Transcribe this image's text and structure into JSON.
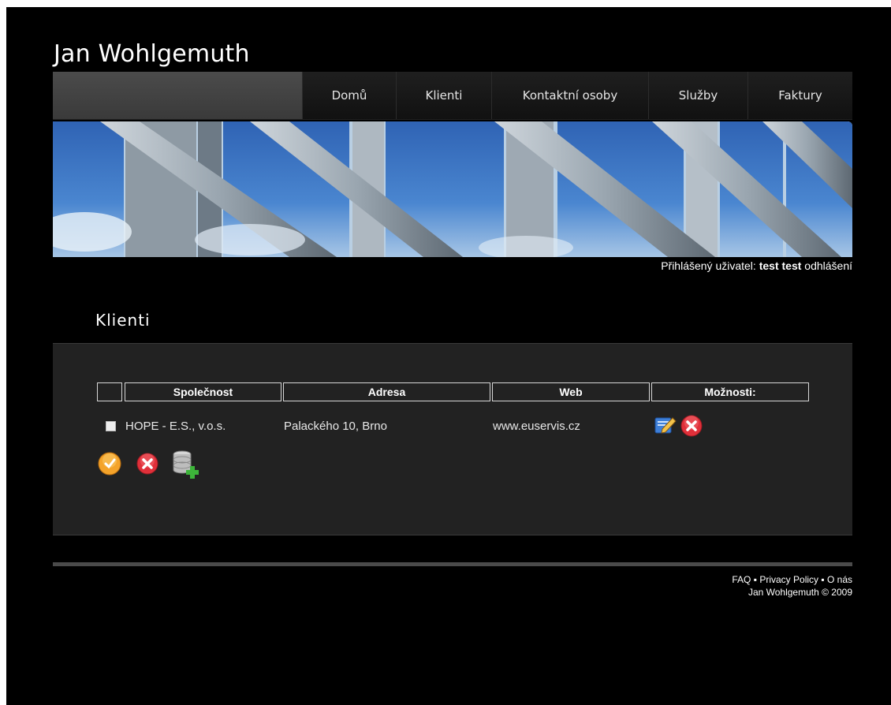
{
  "site": {
    "title": "Jan Wohlgemuth"
  },
  "nav": {
    "items": [
      {
        "label": "Domů"
      },
      {
        "label": "Klienti"
      },
      {
        "label": "Kontaktní osoby"
      },
      {
        "label": "Služby"
      },
      {
        "label": "Faktury"
      }
    ]
  },
  "user": {
    "prefix": "Přihlášený uživatel:",
    "name": "test test",
    "logout": "odhlášení"
  },
  "section": {
    "title": "Klienti"
  },
  "table": {
    "headers": [
      "Společnost",
      "Adresa",
      "Web",
      "Možnosti:"
    ],
    "rows": [
      {
        "company": "HOPE - E.S., v.o.s.",
        "address": "Palackého 10, Brno",
        "web": "www.euservis.cz"
      }
    ]
  },
  "icons": {
    "row_edit": "edit-icon",
    "row_delete": "delete-icon",
    "bulk_select": "select-all-icon",
    "bulk_delete": "delete-icon",
    "add": "add-database-icon"
  },
  "footer": {
    "links": [
      "FAQ",
      "Privacy Policy",
      "O nás"
    ],
    "separator": "▪",
    "copyright": "Jan Wohlgemuth © 2009"
  },
  "colors": {
    "background": "#000000",
    "panel": "#222222",
    "delete_red": "#e0303a",
    "action_orange": "#f4a32a"
  }
}
